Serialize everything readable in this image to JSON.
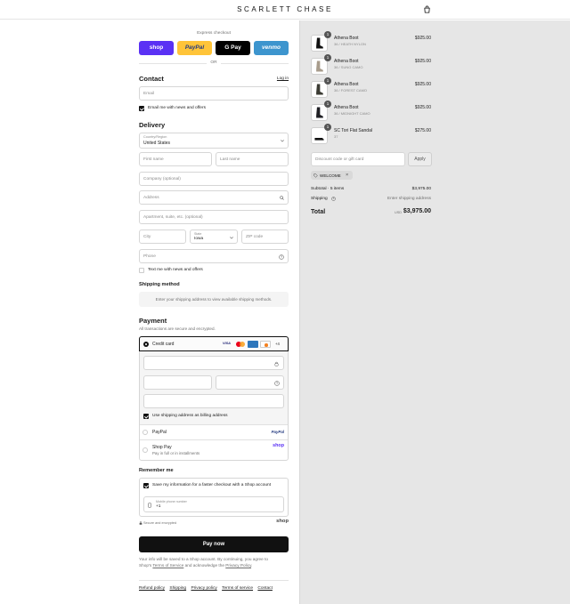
{
  "header": {
    "brand": "SCARLETT CHASE",
    "cart_icon": "shopping-bag-icon"
  },
  "express": {
    "label": "Express checkout",
    "or": "OR",
    "buttons": [
      {
        "label": "shop",
        "color": "#5a31f4"
      },
      {
        "label": "PayPal",
        "color": "#ffc439"
      },
      {
        "label": "G Pay",
        "color": "#000000"
      },
      {
        "label": "venmo",
        "color": "#3d95ce"
      }
    ]
  },
  "contact": {
    "title": "Contact",
    "login": "Log in",
    "email_placeholder": "Email",
    "news_label": "Email me with news and offers",
    "news_checked": true
  },
  "delivery": {
    "title": "Delivery",
    "country_label": "Country/Region",
    "country_value": "United States",
    "first_name": "First name",
    "last_name": "Last name",
    "company": "Company (optional)",
    "address": "Address",
    "apartment": "Apartment, suite, etc. (optional)",
    "city": "City",
    "state_label": "State",
    "state_value": "Iowa",
    "zip": "ZIP code",
    "phone": "Phone",
    "text_label": "Text me with news and offers",
    "text_checked": false
  },
  "shipping_method": {
    "title": "Shipping method",
    "message": "Enter your shipping address to view available shipping methods."
  },
  "payment": {
    "title": "Payment",
    "subtitle": "All transactions are secure and encrypted.",
    "credit_card": "Credit card",
    "card_brands": [
      "VISA",
      "MC",
      "AMEX",
      "DISCOVER"
    ],
    "more_cards": "+4",
    "billing_label": "Use shipping address as billing address",
    "billing_checked": true,
    "paypal": "PayPal",
    "paypal_logo": "PayPal",
    "shoppay": "Shop Pay",
    "shoppay_sub": "Pay in full or in installments",
    "shoppay_logo": "shop"
  },
  "remember": {
    "title": "Remember me",
    "save_label": "Save my information for a faster checkout with a Shop account",
    "save_checked": true,
    "mobile_label": "Mobile phone number",
    "mobile_value": "+1",
    "secure": "Secure and encrypted",
    "shop_logo": "shop"
  },
  "pay_button": "Pay now",
  "legal": {
    "line1": "Your info will be saved to a Shop account. By continuing, you agree to",
    "line2_a": "Shop's ",
    "terms": "Terms of Service",
    "line2_b": " and acknowledge the ",
    "privacy": "Privacy Policy",
    "line2_c": "."
  },
  "footer_links": [
    "Refund policy",
    "Shipping",
    "Privacy policy",
    "Terms of service",
    "Contact"
  ],
  "cart": {
    "items": [
      {
        "name": "Athena Boot",
        "variant": "36 / HEATH NYLON",
        "price": "$925.00",
        "qty": "1"
      },
      {
        "name": "Athena Boot",
        "variant": "36 / SUNG CAMO",
        "price": "$925.00",
        "qty": "1"
      },
      {
        "name": "Athena Boot",
        "variant": "36 / FOREST CAMO",
        "price": "$925.00",
        "qty": "1"
      },
      {
        "name": "Athena Boot",
        "variant": "36 / MIDNIGHT CAMO",
        "price": "$925.00",
        "qty": "1"
      },
      {
        "name": "SC Tori Flat Sandal",
        "variant": "37",
        "price": "$275.00",
        "qty": "1"
      }
    ],
    "discount_placeholder": "Discount code or gift card",
    "apply": "Apply",
    "tag": "WELCOME",
    "subtotal_label": "Subtotal · 5 items",
    "subtotal_value": "$3,975.00",
    "shipping_label": "Shipping",
    "shipping_value": "Enter shipping address",
    "total_label": "Total",
    "currency": "USD",
    "total_value": "$3,975.00"
  }
}
